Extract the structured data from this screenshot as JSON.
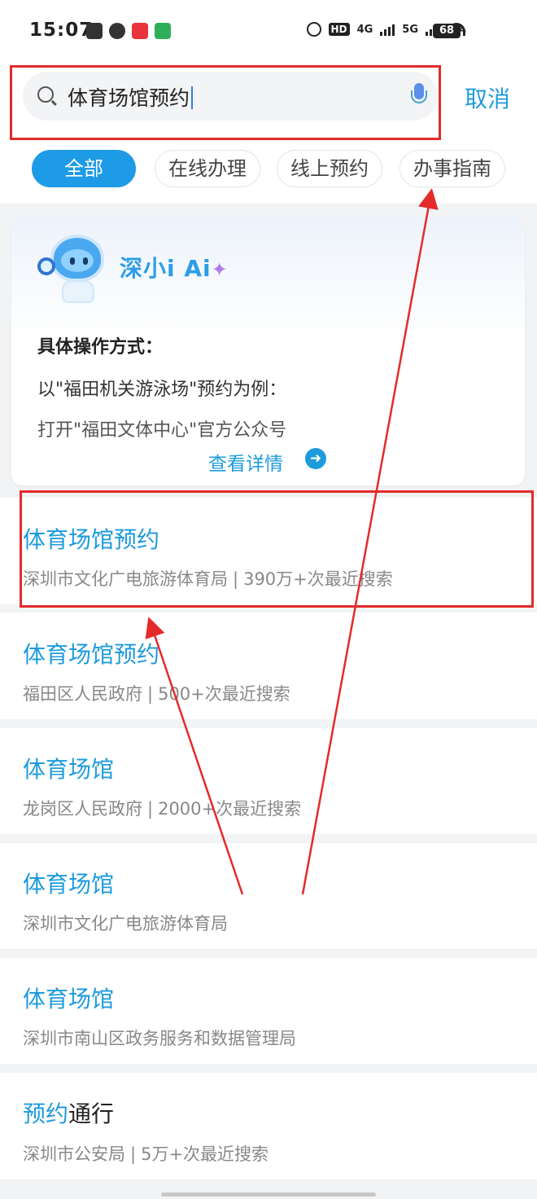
{
  "status_bar": {
    "time": "15:07",
    "signal_4g": "4G",
    "signal_5g": "5G",
    "hd": "HD",
    "battery": "68",
    "accent_icons": [
      "#333333",
      "#333333",
      "#e8343b",
      "#2fae5a"
    ]
  },
  "search": {
    "query": "体育场馆预约",
    "cancel_label": "取消"
  },
  "tabs": [
    {
      "label": "全部",
      "active": true
    },
    {
      "label": "在线办理",
      "active": false
    },
    {
      "label": "线上预约",
      "active": false
    },
    {
      "label": "办事指南",
      "active": false
    }
  ],
  "ai_card": {
    "title": "深小i Ai",
    "sparkle": "✦",
    "heading": "具体操作方式：",
    "line1": "以\"福田机关游泳场\"预约为例：",
    "line2": "打开\"福田文体中心\"官方公众号",
    "more_label": "查看详情",
    "more_icon": "arrow-right-icon"
  },
  "results": [
    {
      "title": "体育场馆预约",
      "title_plain": "",
      "department": "深圳市文化广电旅游体育局",
      "separator": "|",
      "searches": "390万+次最近搜索"
    },
    {
      "title": "体育场馆预约",
      "title_plain": "",
      "department": "福田区人民政府",
      "separator": "|",
      "searches": "500+次最近搜索"
    },
    {
      "title": "体育场馆",
      "title_plain": "",
      "department": "龙岗区人民政府",
      "separator": "|",
      "searches": "2000+次最近搜索"
    },
    {
      "title": "体育场馆",
      "title_plain": "",
      "department": "深圳市文化广电旅游体育局",
      "separator": "",
      "searches": ""
    },
    {
      "title": "体育场馆",
      "title_plain": "",
      "department": "深圳市南山区政务服务和数据管理局",
      "separator": "",
      "searches": ""
    },
    {
      "title": "预约",
      "title_plain": "通行",
      "department": "深圳市公安局",
      "separator": "|",
      "searches": "5万+次最近搜索"
    }
  ],
  "colors": {
    "accent": "#1d9bdc",
    "annotation_red": "#e52a2a"
  }
}
